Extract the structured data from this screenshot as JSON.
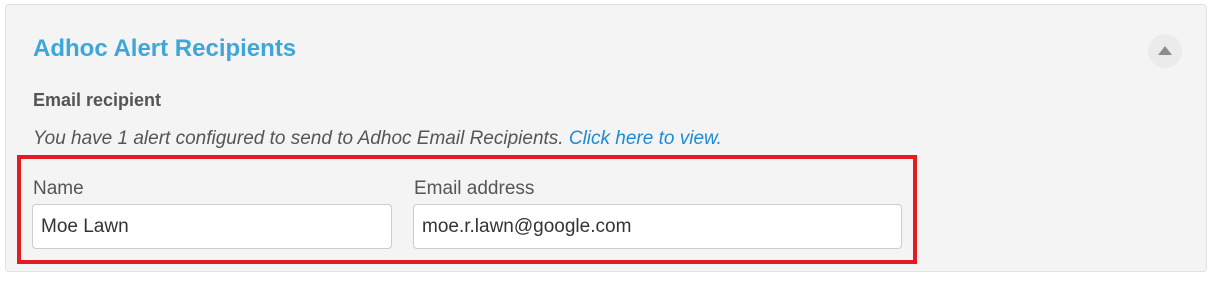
{
  "panel": {
    "title": "Adhoc Alert Recipients",
    "collapse_icon": "chevron-up-icon"
  },
  "email_recipient": {
    "section_label": "Email recipient",
    "info_text": "You have 1 alert configured to send to Adhoc Email Recipients.",
    "info_link": "Click here to view."
  },
  "fields": {
    "name": {
      "label": "Name",
      "value": "Moe Lawn"
    },
    "email": {
      "label": "Email address",
      "value": "moe.r.lawn@google.com"
    }
  },
  "colors": {
    "title": "#3ea6d8",
    "link": "#1f8ad6",
    "highlight": "#e31b23",
    "panel_bg": "#f4f4f4"
  }
}
